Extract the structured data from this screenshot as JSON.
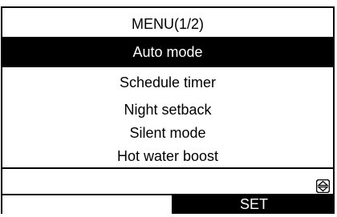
{
  "menu": {
    "title": "MENU(1/2)",
    "items": [
      {
        "label": "Auto mode",
        "selected": true
      },
      {
        "label": "Schedule timer",
        "selected": false
      },
      {
        "label": "Night setback",
        "selected": false
      },
      {
        "label": "Silent mode",
        "selected": false
      },
      {
        "label": "Hot water boost",
        "selected": false
      }
    ]
  },
  "softkeys": {
    "left_label": "",
    "right_label": "SET"
  },
  "icons": {
    "scroll": "up-down-scroll-icon"
  }
}
